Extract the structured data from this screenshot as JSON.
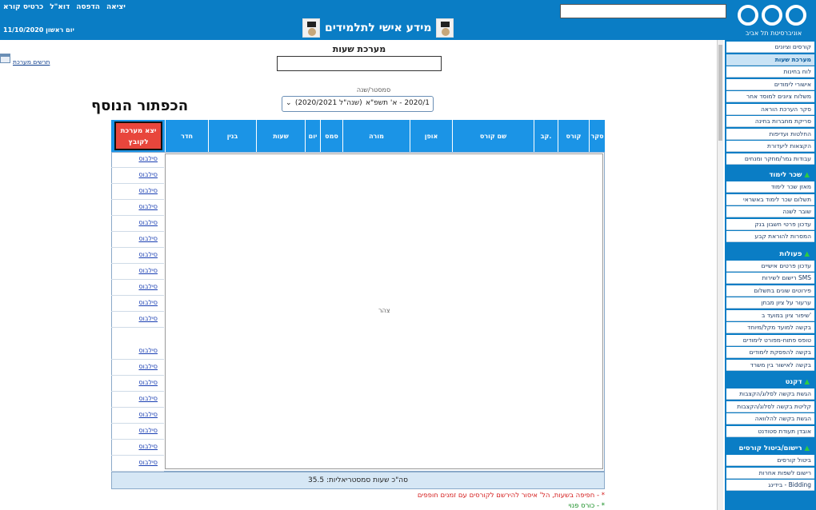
{
  "header": {
    "title": "מידע אישי לתלמידים",
    "date": "יום ראשון 11/10/2020",
    "links": [
      "יציאה",
      "הדפסה",
      "דוא\"ל",
      "כרטיס קורא"
    ],
    "university": "אוניברסיטת תל אביב",
    "search_value": ""
  },
  "schedule": {
    "label": "מערכת שעות",
    "semester_label": "סמסטר/שנה",
    "semester_value": "2020/1 - א' תשפ\"א",
    "semester_year": "(שנה\"ל 2020/2021)",
    "calendar_link": "תרשים מערכת",
    "big_title": "הכפתור הנוסף",
    "print_button": "יצא מערכת לקובץ",
    "columns": [
      "סקר",
      "קורס",
      "קב.",
      "שם קורס",
      "אופן",
      "מורה",
      "סמס",
      "יום",
      "שעות",
      "בנין",
      "חדר"
    ],
    "empty_text": "צהר",
    "room_link": "סילבוס",
    "total": "סה\"כ שעות סמסטריאליות: 35.5",
    "note1": "* - חפיפה בשעות, הל' איסור להירשם לקורסים עם זמנים חופפים",
    "note2": "* - כורס פנוי"
  },
  "sidebar": {
    "items": [
      {
        "label": "קורסים וציונים"
      },
      {
        "label": "מערכת שעות",
        "selected": true
      },
      {
        "label": "לוח בחינות"
      },
      {
        "label": "אישורי לימודים"
      },
      {
        "label": "משלוח ציונים למוסד אחר"
      },
      {
        "label": "סקר הערכת הוראה"
      },
      {
        "label": "סריקת מחברות בחינה"
      },
      {
        "label": "החלטות ועדיפות"
      },
      {
        "label": "הקצאות ליעדורת"
      },
      {
        "label": "עבודות גמר/מחקר ומנחים"
      }
    ],
    "sections": [
      {
        "title": "שכר לימוד",
        "items": [
          "מאזן שכר לימוד",
          "תשלום שכר לימוד באשראי",
          "שובר לשנה",
          "עדכון פרטי חשבון בנק",
          "המסרות להוראת קבע"
        ]
      },
      {
        "title": "פעולות",
        "items": [
          "עדכון פרטים אישיים",
          "רישום לשירות SMS",
          "פירוטים שונים בתשלום",
          "ערעור על ציון מבחן",
          "שיפור ציון במועד ב'",
          "בקשה למועד מקל/מיוחד",
          "טופס פתוח-מפורט לימודים",
          "בקשה להפסקת לימודים",
          "בקשה לאישור בין משרד"
        ]
      },
      {
        "title": "דקנט",
        "items": [
          "הגשת בקשה לסלוג/הקצבות",
          "קליטת בקשה לסלוג/הקצבות",
          "הגשת בקשה להלוואה",
          "אובדן תעודת סטודנט"
        ]
      },
      {
        "title": "רישום/ביטול קורסים",
        "items": [
          "ביטול קורסים",
          "רישום לשפות אחרות",
          "בידינג - Bidding"
        ]
      }
    ]
  }
}
